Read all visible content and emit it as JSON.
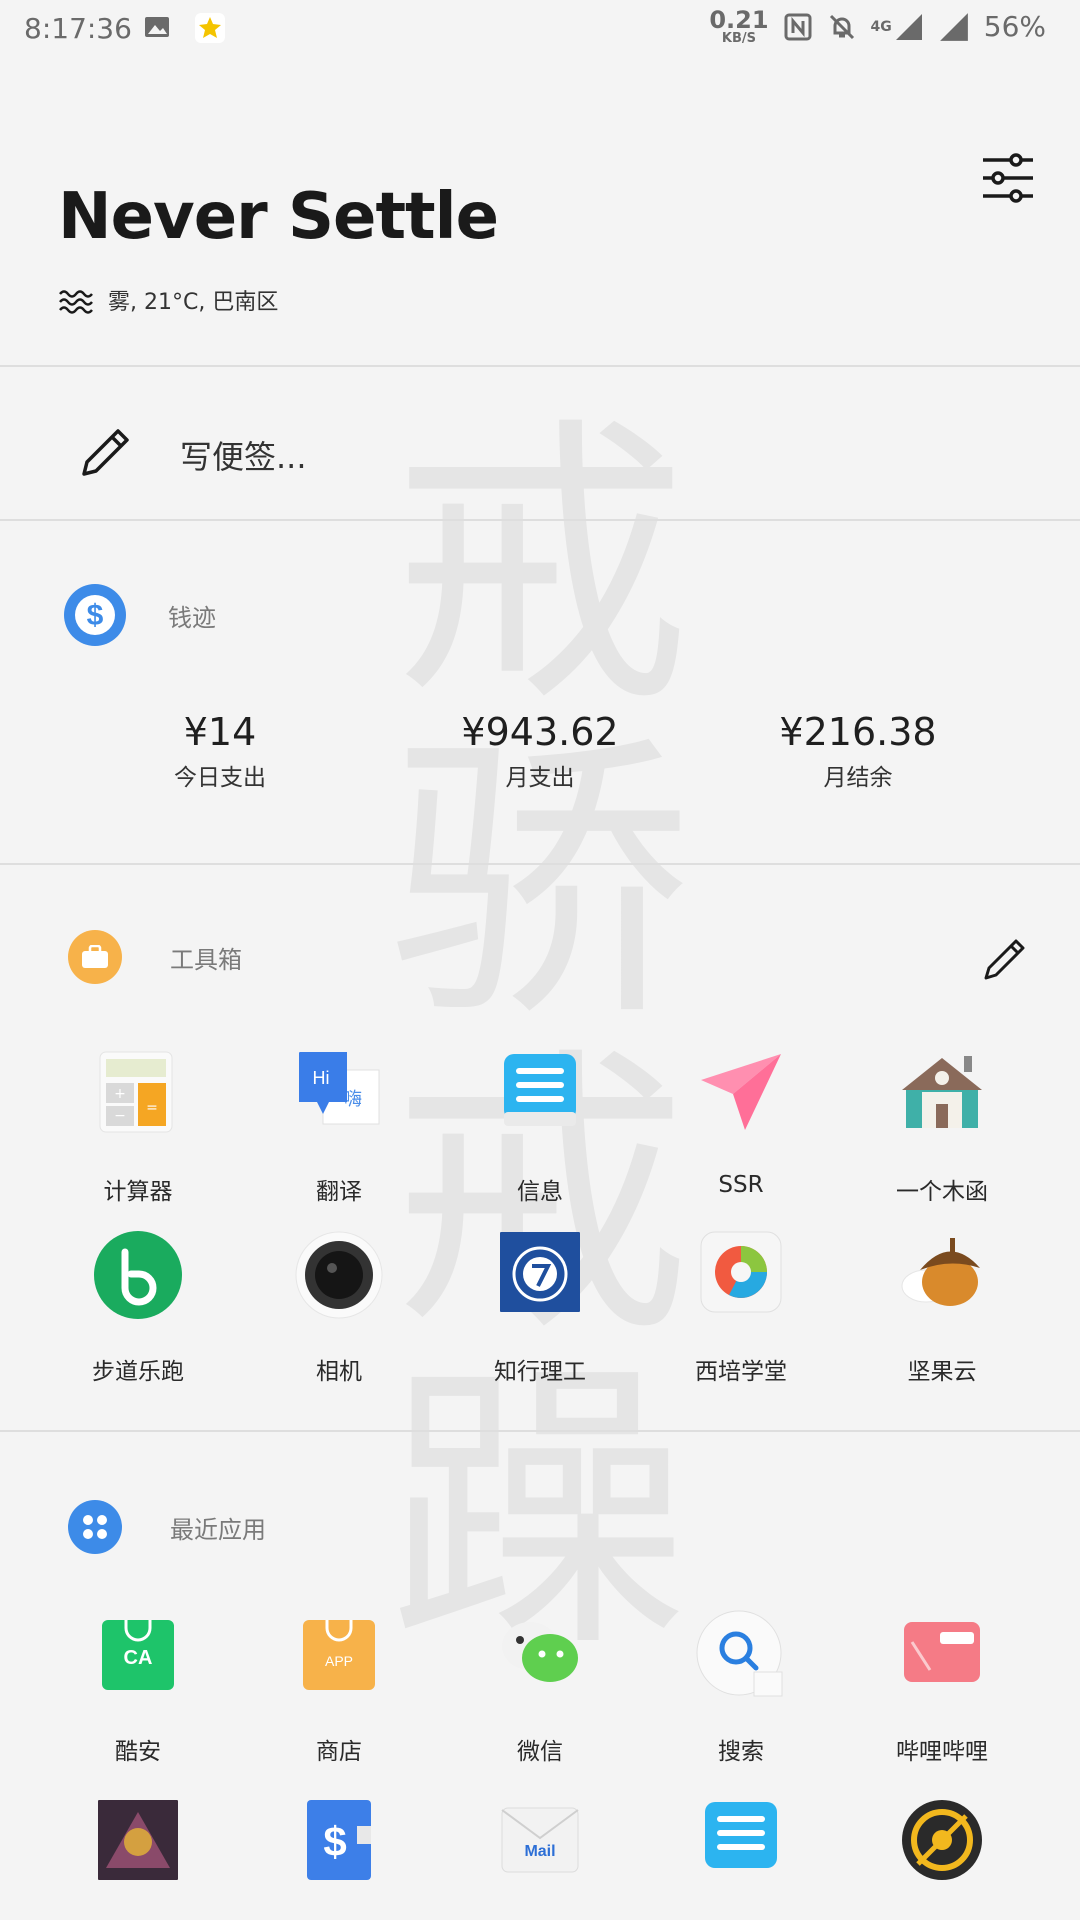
{
  "status_bar": {
    "time": "8:17:36",
    "net_speed": "0.21",
    "net_unit": "KB/S",
    "network": "4G",
    "battery": "56%"
  },
  "header": {
    "title": "Never Settle",
    "weather": "雾, 21°C, 巴南区"
  },
  "note": {
    "placeholder": "写便签..."
  },
  "money": {
    "title": "钱迹",
    "stats": [
      {
        "amount": "¥14",
        "label": "今日支出"
      },
      {
        "amount": "¥943.62",
        "label": "月支出"
      },
      {
        "amount": "¥216.38",
        "label": "月结余"
      }
    ]
  },
  "toolbox": {
    "title": "工具箱",
    "apps": [
      {
        "name": "计算器",
        "icon": "calculator-icon"
      },
      {
        "name": "翻译",
        "icon": "translate-icon"
      },
      {
        "name": "信息",
        "icon": "messages-icon"
      },
      {
        "name": "SSR",
        "icon": "paper-plane-icon"
      },
      {
        "name": "一个木函",
        "icon": "house-icon"
      },
      {
        "name": "步道乐跑",
        "icon": "run-icon"
      },
      {
        "name": "相机",
        "icon": "camera-icon"
      },
      {
        "name": "知行理工",
        "icon": "university-icon"
      },
      {
        "name": "西培学堂",
        "icon": "xipei-icon"
      },
      {
        "name": "坚果云",
        "icon": "acorn-icon"
      }
    ]
  },
  "recent": {
    "title": "最近应用",
    "apps": [
      {
        "name": "酷安",
        "icon": "coolapk-icon"
      },
      {
        "name": "商店",
        "icon": "store-icon"
      },
      {
        "name": "微信",
        "icon": "wechat-icon"
      },
      {
        "name": "搜索",
        "icon": "search-icon"
      },
      {
        "name": "哔哩哔哩",
        "icon": "bilibili-icon"
      }
    ],
    "row2_icons": [
      "game-icon",
      "money-app-icon",
      "mail-icon",
      "messages-icon",
      "target-icon"
    ]
  },
  "colors": {
    "money_blue": "#3d8be8",
    "toolbox_orange": "#f7b24a",
    "recent_blue": "#3d8be8",
    "background": "#f4f4f4"
  }
}
